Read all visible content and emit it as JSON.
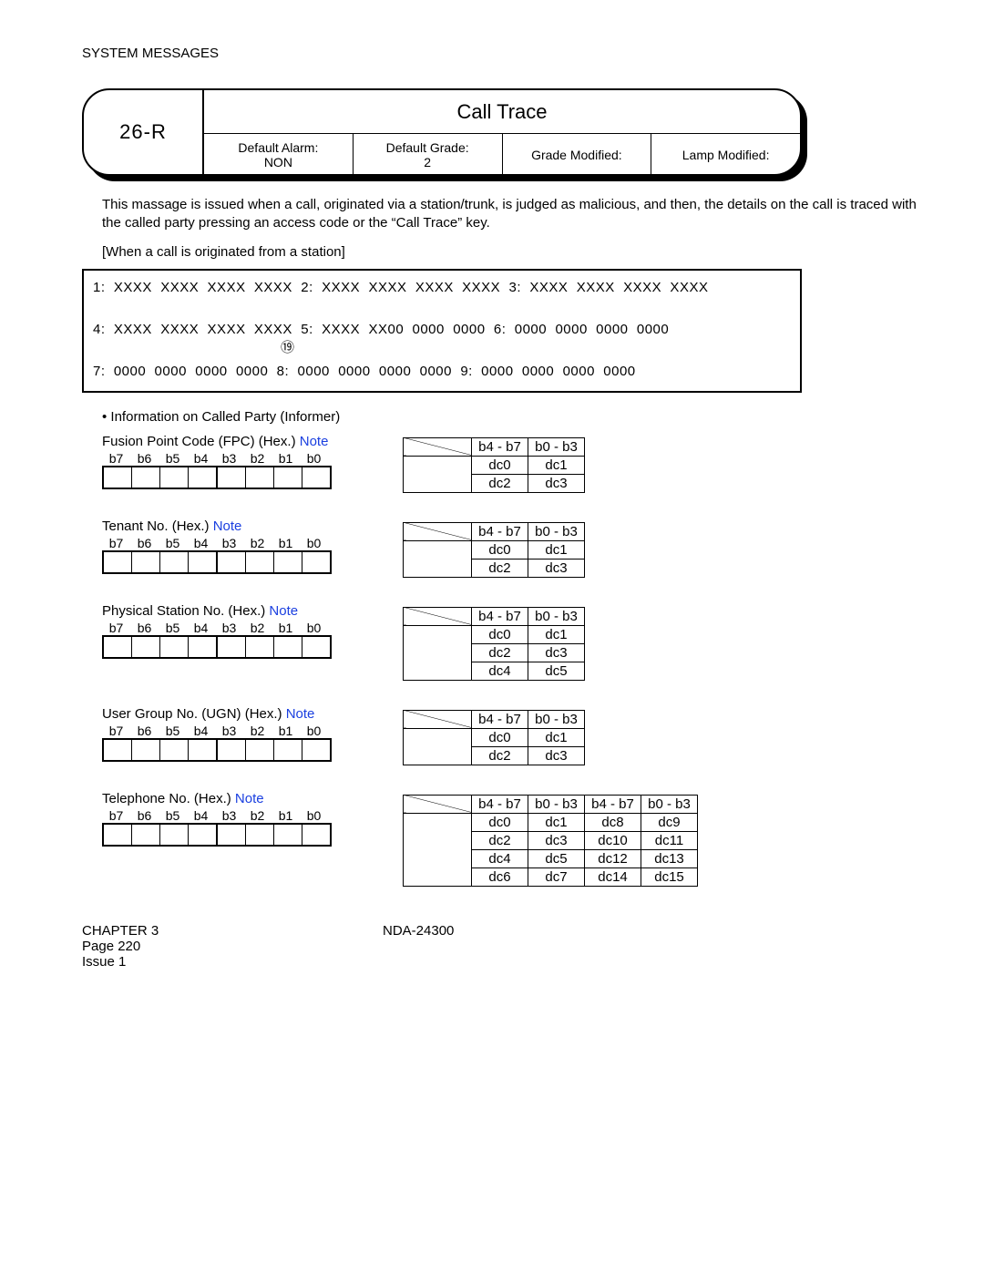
{
  "header": "SYSTEM MESSAGES",
  "code": "26-R",
  "title": "Call Trace",
  "info": {
    "da_label": "Default Alarm:",
    "da_value": "NON",
    "dg_label": "Default Grade:",
    "dg_value": "2",
    "gm_label": "Grade Modified:",
    "lm_label": "Lamp Modified:"
  },
  "paragraph": "This massage is issued when a call, originated via a station/trunk, is judged as malicious, and then, the details on the call is traced with the called party pressing an access code or the “Call Trace” key.",
  "subheading": "[When a call is originated from a station]",
  "data_lines": [
    "1:  XXXX  XXXX  XXXX  XXXX  2:  XXXX  XXXX  XXXX  XXXX  3:  XXXX  XXXX  XXXX  XXXX",
    "4:  XXXX  XXXX  XXXX  XXXX  5:  XXXX  XX00  0000  0000  6:  0000  0000  0000  0000",
    "7:  0000  0000  0000  0000  8:  0000  0000  0000  0000  9:  0000  0000  0000  0000"
  ],
  "circled": "⑲",
  "bullet": "Information on Called Party (Informer)",
  "note": "Note",
  "bits": [
    "b7",
    "b6",
    "b5",
    "b4",
    "b3",
    "b2",
    "b1",
    "b0"
  ],
  "bt": "b4 - b7",
  "bl": "b0 - b3",
  "sections": [
    {
      "title": "Fusion Point Code (FPC) (Hex.) ",
      "rows": [
        "dc0|dc1",
        "dc2|dc3"
      ]
    },
    {
      "title": "Tenant No. (Hex.)  ",
      "rows": [
        "dc0|dc1",
        "dc2|dc3"
      ]
    },
    {
      "title": "Physical Station No. (Hex.) ",
      "rows": [
        "dc0|dc1",
        "dc2|dc3",
        "dc4|dc5"
      ]
    },
    {
      "title": "User Group No. (UGN) (Hex.) ",
      "rows": [
        "dc0|dc1",
        "dc2|dc3"
      ]
    },
    {
      "title": "Telephone No. (Hex.) ",
      "rows4": [
        "dc0|dc1|dc8|dc9",
        "dc2|dc3|dc10|dc11",
        "dc4|dc5|dc12|dc13",
        "dc6|dc7|dc14|dc15"
      ]
    }
  ],
  "footer": {
    "chapter": "CHAPTER 3",
    "page": "Page 220",
    "issue": "Issue 1",
    "docno": "NDA-24300"
  }
}
